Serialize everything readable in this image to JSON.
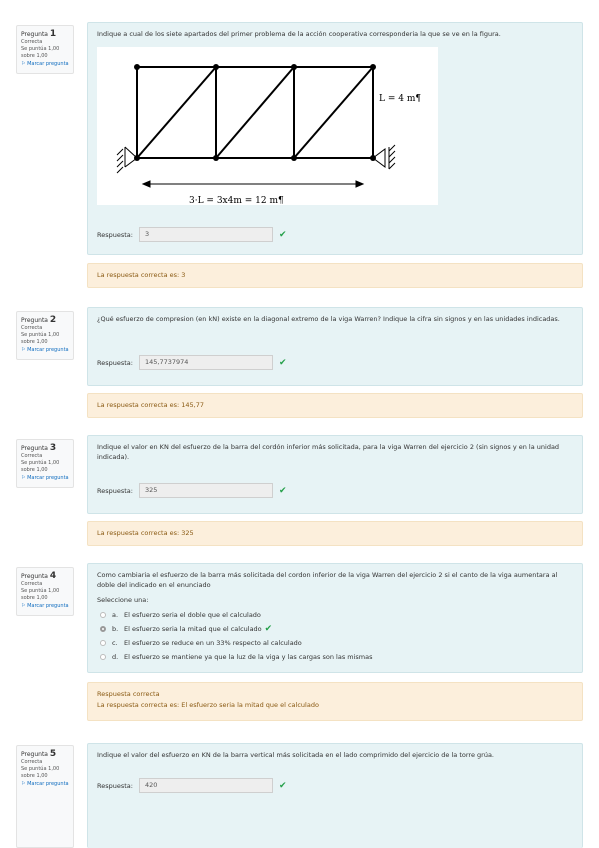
{
  "questions": [
    {
      "info": {
        "label": "Pregunta",
        "number": "1",
        "status": "Correcta",
        "score": "Se puntúa 1,00",
        "total": "sobre 1,00",
        "flag": "Marcar pregunta"
      },
      "text": "Indique a cual de los siete apartados del primer problema de la acción cooperativa corresponderia la que se ve en la figura.",
      "figure": {
        "dim_h": "L = 4 m¶",
        "dim_w": "3·L = 3x4m = 12 m¶"
      },
      "answer_label": "Respuesta:",
      "answer": "3",
      "feedback": "La respuesta correcta es: 3"
    },
    {
      "info": {
        "label": "Pregunta",
        "number": "2",
        "status": "Correcta",
        "score": "Se puntúa 1,00",
        "total": "sobre 1,00",
        "flag": "Marcar pregunta"
      },
      "text": "¿Qué esfuerzo de compresion (en kN) existe en la diagonal extremo de la viga Warren? Indique la cifra sin signos y en las unidades indicadas.",
      "answer_label": "Respuesta:",
      "answer": "145,7737974",
      "feedback": "La respuesta correcta es: 145,77"
    },
    {
      "info": {
        "label": "Pregunta",
        "number": "3",
        "status": "Correcta",
        "score": "Se puntúa 1,00",
        "total": "sobre 1,00",
        "flag": "Marcar pregunta"
      },
      "text": "Indique el valor en KN del esfuerzo de la barra del cordón inferior más solicitada, para la viga Warren del ejercicio 2 (sin signos y en la unidad indicada).",
      "answer_label": "Respuesta:",
      "answer": "325",
      "feedback": "La respuesta correcta es: 325"
    },
    {
      "info": {
        "label": "Pregunta",
        "number": "4",
        "status": "Correcta",
        "score": "Se puntúa 1,00",
        "total": "sobre 1,00",
        "flag": "Marcar pregunta"
      },
      "text": "Como cambiaria el esfuerzo de la barra más solicitada del cordon inferior de la viga Warren del ejercicio 2 si el canto de la viga aumentara al doble del indicado en el enunciado",
      "select_label": "Seleccione una:",
      "options": [
        {
          "letter": "a.",
          "text": "El esfuerzo seria el doble que el calculado"
        },
        {
          "letter": "b.",
          "text": "El esfuerzo seria la mitad que el calculado"
        },
        {
          "letter": "c.",
          "text": "El esfuerzo se reduce en un 33% respecto al calculado"
        },
        {
          "letter": "d.",
          "text": "El esfuerzo se mantiene ya que la luz de la viga y las cargas son las mismas"
        }
      ],
      "selected": "b",
      "feedback_title": "Respuesta correcta",
      "feedback": "La respuesta correcta es: El esfuerzo seria la mitad que el calculado"
    },
    {
      "info": {
        "label": "Pregunta",
        "number": "5",
        "status": "Correcta",
        "score": "Se puntúa 1,00",
        "total": "sobre 1,00",
        "flag": "Marcar pregunta"
      },
      "text": "Indique el valor del esfuerzo en KN de la barra vertical más solicitada en el lado comprimido del ejercicio de la torre grúa.",
      "answer_label": "Respuesta:",
      "answer": "420"
    }
  ],
  "colors": {
    "content_bg": "#e7f3f5",
    "feedback_bg": "#fcefdc",
    "check": "#25a04a",
    "link": "#0f6cbf"
  }
}
